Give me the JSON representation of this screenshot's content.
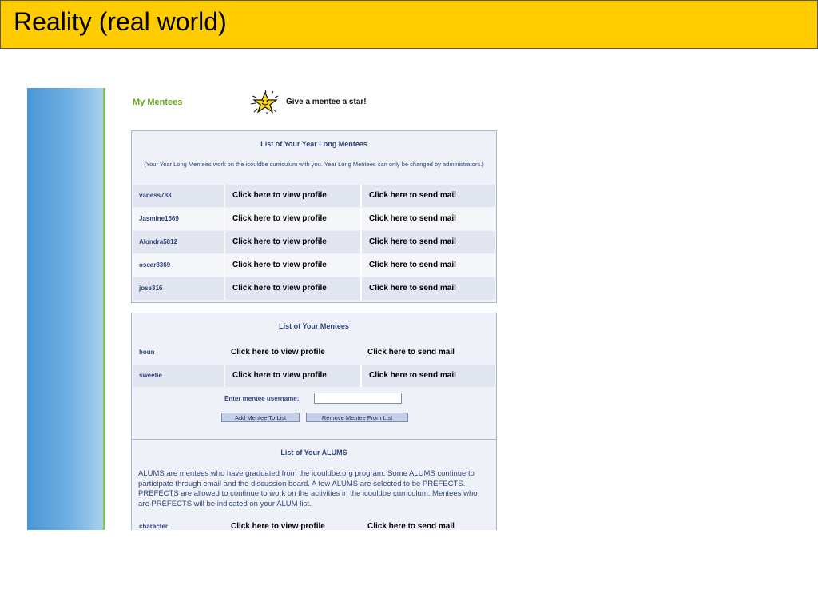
{
  "slide": {
    "title": "Reality (real world)"
  },
  "header": {
    "section_title": "My Mentees",
    "star_text": "Give a mentee a star!"
  },
  "year_long": {
    "title": "List of Your Year Long Mentees",
    "note": "(Your Year Long Mentees work on the icouldbe curriculum with you. Year Long Mentees can only be changed by administrators.)",
    "rows": [
      {
        "name": "vaness783",
        "profile": "Click here to view profile",
        "mail": "Click here to send mail"
      },
      {
        "name": "Jasmine1569",
        "profile": "Click here to view profile",
        "mail": "Click here to send mail"
      },
      {
        "name": "Alondra5812",
        "profile": "Click here to view profile",
        "mail": "Click here to send mail"
      },
      {
        "name": "oscar8369",
        "profile": "Click here to view profile",
        "mail": "Click here to send mail"
      },
      {
        "name": "jose316",
        "profile": "Click here to view profile",
        "mail": "Click here to send mail"
      }
    ]
  },
  "mentees": {
    "title": "List of Your Mentees",
    "rows": [
      {
        "name": "boun",
        "profile": "Click here to view profile",
        "mail": "Click here to send mail"
      },
      {
        "name": "sweetie",
        "profile": "Click here to view profile",
        "mail": "Click here to send mail"
      }
    ],
    "enter_label": "Enter mentee username:",
    "username_value": "",
    "add_button": "Add Mentee To List",
    "remove_button": "Remove Mentee From List"
  },
  "alums": {
    "title": "List of Your ALUMS",
    "description": "ALUMS are mentees who have graduated from the icouldbe.org program. Some ALUMS continue to participate through email and the discussion board. A few ALUMS are selected to be PREFECTS. PREFECTS are allowed to continue to work on the activities in the icouldbe curriculum. Mentees who are PREFECTS will be indicated on your ALUM list.",
    "rows": [
      {
        "name": "character",
        "profile": "Click here to view profile",
        "mail": "Click here to send mail"
      }
    ]
  },
  "colors": {
    "title_bg": "#ffcc00",
    "link_blue": "#33447a",
    "accent_green": "#6aa622",
    "panel_bg": "#eef1f8"
  },
  "icons": {
    "star": "star-icon"
  }
}
